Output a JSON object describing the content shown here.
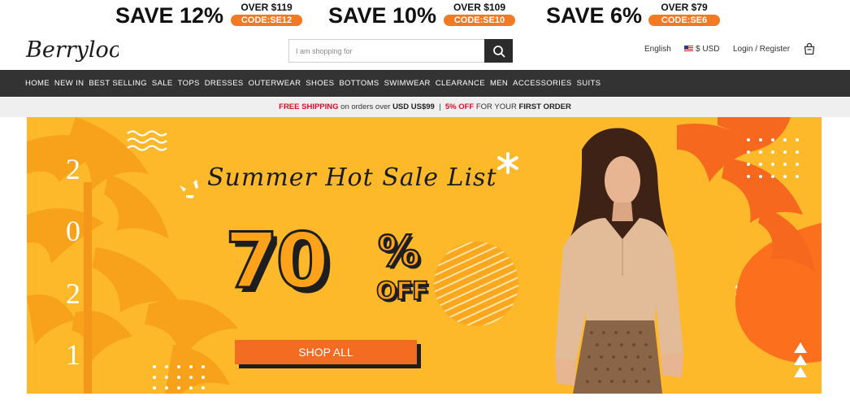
{
  "promos": [
    {
      "save": "SAVE 12%",
      "over": "OVER $119",
      "code": "CODE:SE12"
    },
    {
      "save": "SAVE 10%",
      "over": "OVER $109",
      "code": "CODE:SE10"
    },
    {
      "save": "SAVE 6%",
      "over": "OVER $79",
      "code": "CODE:SE6"
    }
  ],
  "header": {
    "logo_text": "Berrylook",
    "search_placeholder": "I am shopping for",
    "language": "English",
    "currency": "$ USD",
    "login": "Login / Register",
    "icons": {
      "search": "search-icon",
      "bag": "shopping-bag-icon",
      "flag": "us-flag-icon"
    }
  },
  "nav": [
    "HOME",
    "NEW IN",
    "BEST SELLING",
    "SALE",
    "TOPS",
    "DRESSES",
    "OUTERWEAR",
    "SHOES",
    "BOTTOMS",
    "SWIMWEAR",
    "CLEARANCE",
    "MEN",
    "ACCESSORIES",
    "SUITS"
  ],
  "shipping": {
    "free": "FREE SHIPPING",
    "text1": " on orders over ",
    "amount": "USD US$99",
    "sep": "  |  ",
    "off": "5% OFF",
    "text2": " FOR YOUR ",
    "first": "FIRST ORDER"
  },
  "banner": {
    "year_digits": [
      "2",
      "0",
      "2",
      "1"
    ],
    "script_title": "Summer Hot Sale List",
    "big_number": "70",
    "percent": "%",
    "off": "OFF",
    "button": "SHOP ALL",
    "colors": {
      "background": "#fdb92a",
      "accent": "#f36c21",
      "outline": "#1e1e1e"
    }
  }
}
